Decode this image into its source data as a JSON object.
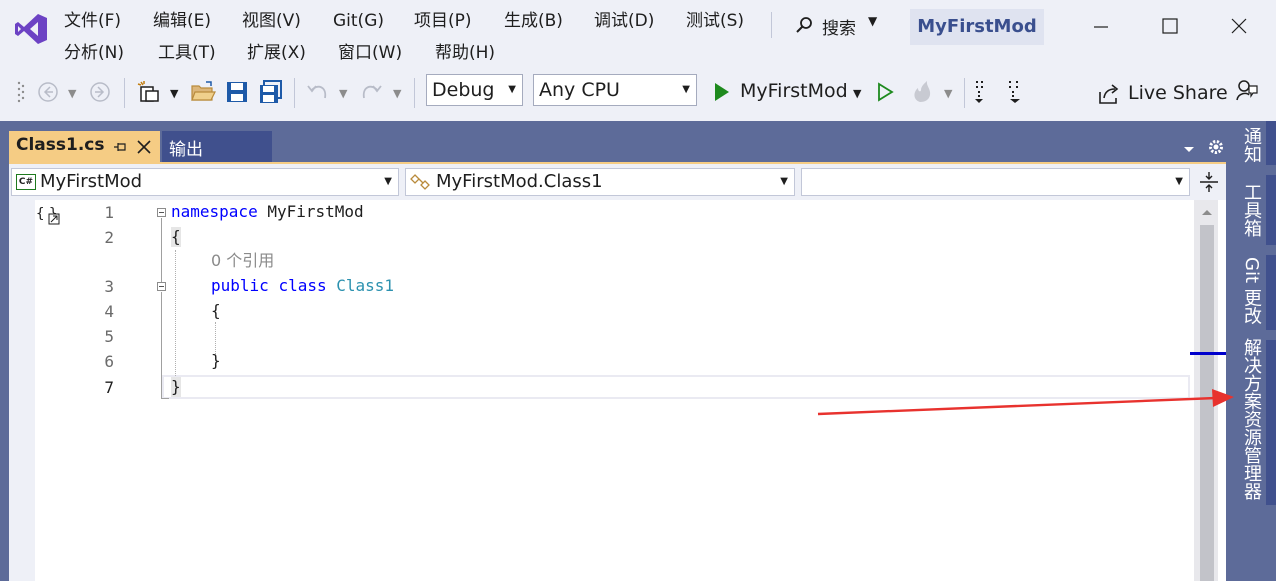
{
  "menu": {
    "row1": [
      "文件(F)",
      "编辑(E)",
      "视图(V)",
      "Git(G)",
      "项目(P)",
      "生成(B)",
      "调试(D)",
      "测试(S)"
    ],
    "row2": [
      "分析(N)",
      "工具(T)",
      "扩展(X)",
      "窗口(W)",
      "帮助(H)"
    ]
  },
  "search": {
    "label": "搜索",
    "icon": "search-icon"
  },
  "app_title": "MyFirstMod",
  "toolbar": {
    "config": "Debug",
    "platform": "Any CPU",
    "run_target": "MyFirstMod",
    "live_share": "Live Share"
  },
  "tabs": [
    {
      "label": "Class1.cs",
      "active": true
    },
    {
      "label": "输出",
      "active": false
    }
  ],
  "navbar": {
    "project": "MyFirstMod",
    "project_badge": "C#",
    "type": "MyFirstMod.Class1",
    "member": ""
  },
  "code": {
    "line_numbers": [
      "1",
      "2",
      "3",
      "4",
      "5",
      "6",
      "7"
    ],
    "l1_kw": "namespace",
    "l1_name": "MyFirstMod",
    "l2": "{",
    "refs_hint": "0 个引用",
    "l3_kw1": "public",
    "l3_kw2": "class",
    "l3_type": "Class1",
    "l4": "{",
    "l6": "}",
    "l7": "}"
  },
  "right_rail": [
    "通知",
    "工具箱",
    "Git 更改",
    "解决方案资源管理器"
  ],
  "colors": {
    "chrome": "#eef0f7",
    "frame": "#5d6b99",
    "active_tab": "#f5cc84",
    "keyword": "#0000ff",
    "type": "#2b91af",
    "arrow": "#e8322e"
  }
}
